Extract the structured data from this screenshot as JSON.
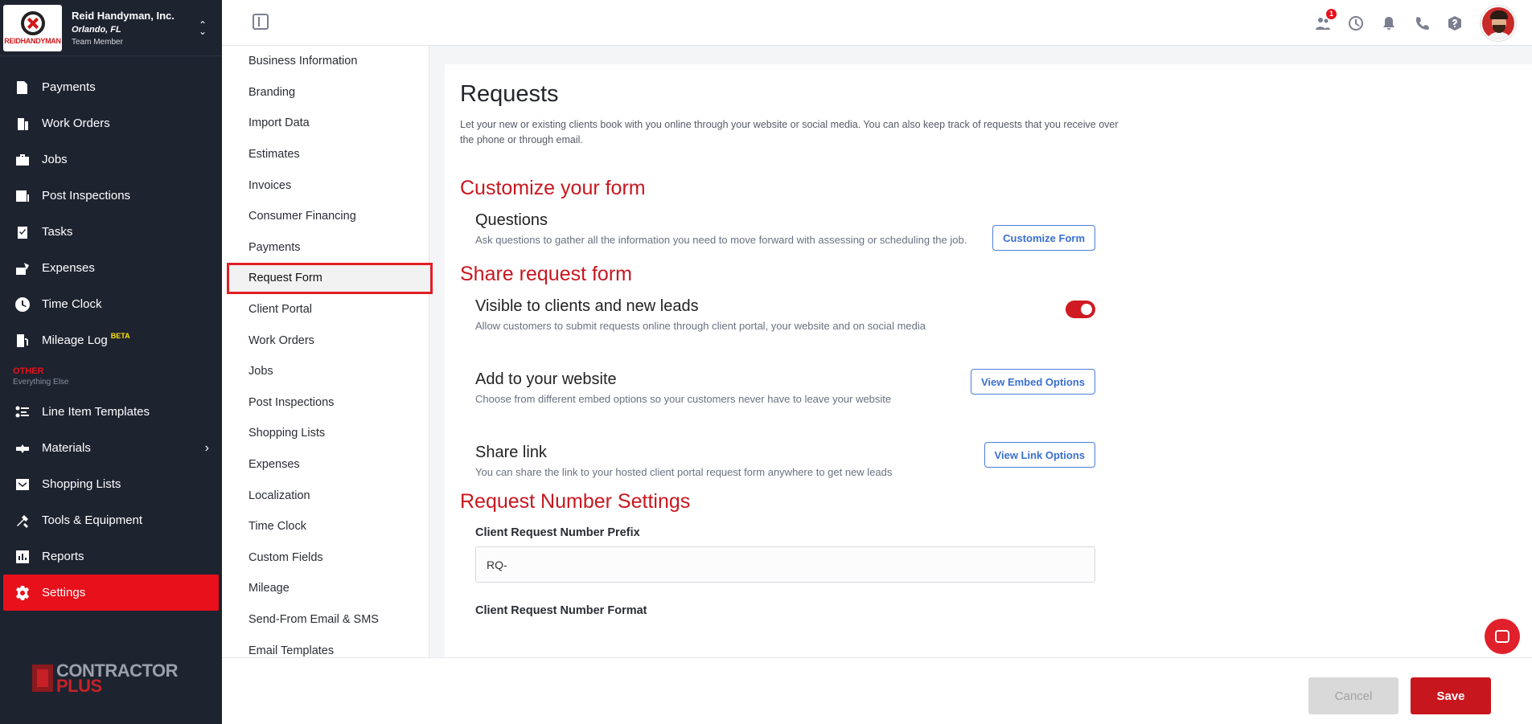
{
  "company": {
    "name": "Reid Handyman, Inc.",
    "location": "Orlando, FL",
    "role": "Team Member",
    "logo_text": "REIDHANDYMAN"
  },
  "sidebar": {
    "items": [
      {
        "label": "Payments",
        "icon": "payments-icon"
      },
      {
        "label": "Work Orders",
        "icon": "work-orders-icon"
      },
      {
        "label": "Jobs",
        "icon": "briefcase-icon"
      },
      {
        "label": "Post Inspections",
        "icon": "inspection-icon"
      },
      {
        "label": "Tasks",
        "icon": "clipboard-check-icon"
      },
      {
        "label": "Expenses",
        "icon": "expenses-icon"
      },
      {
        "label": "Time Clock",
        "icon": "clock-icon"
      },
      {
        "label": "Mileage Log",
        "icon": "fuel-icon",
        "badge": "BETA"
      }
    ],
    "other_title": "OTHER",
    "other_subtitle": "Everything Else",
    "other_items": [
      {
        "label": "Line Item Templates",
        "icon": "list-icon"
      },
      {
        "label": "Materials",
        "icon": "materials-icon"
      },
      {
        "label": "Shopping Lists",
        "icon": "cart-icon"
      },
      {
        "label": "Tools & Equipment",
        "icon": "tools-icon"
      },
      {
        "label": "Reports",
        "icon": "chart-icon"
      },
      {
        "label": "Settings",
        "icon": "gear-icon"
      }
    ],
    "brand_line1": "CONTRACTOR",
    "brand_line2": "PLUS"
  },
  "topbar": {
    "notification_count": "1"
  },
  "subnav": {
    "items": [
      "Business Information",
      "Branding",
      "Import Data",
      "Estimates",
      "Invoices",
      "Consumer Financing",
      "Payments",
      "Request Form",
      "Client Portal",
      "Work Orders",
      "Jobs",
      "Post Inspections",
      "Shopping Lists",
      "Expenses",
      "Localization",
      "Time Clock",
      "Custom Fields",
      "Mileage",
      "Send-From Email & SMS",
      "Email Templates"
    ],
    "active": "Request Form"
  },
  "main": {
    "title": "Requests",
    "description": "Let your new or existing clients book with you online through your website or social media. You can also keep track of requests that you receive over the phone or through email.",
    "customize": {
      "heading": "Customize your form",
      "questions_title": "Questions",
      "questions_desc": "Ask questions to gather all the information you need to move forward with assessing or scheduling the job.",
      "button": "Customize Form"
    },
    "share": {
      "heading": "Share request form",
      "visible_title": "Visible to clients and new leads",
      "visible_desc": "Allow customers to submit requests online through client portal, your website and on social media",
      "visible_on": true,
      "website_title": "Add to your website",
      "website_desc": "Choose from different embed options so your customers never have to leave your website",
      "website_button": "View Embed Options",
      "link_title": "Share link",
      "link_desc": "You can share the link to your hosted client portal request form anywhere to get new leads",
      "link_button": "View Link Options"
    },
    "number": {
      "heading": "Request Number Settings",
      "prefix_label": "Client Request Number Prefix",
      "prefix_value": "RQ-",
      "format_label": "Client Request Number Format"
    }
  },
  "footer": {
    "cancel": "Cancel",
    "save": "Save"
  }
}
